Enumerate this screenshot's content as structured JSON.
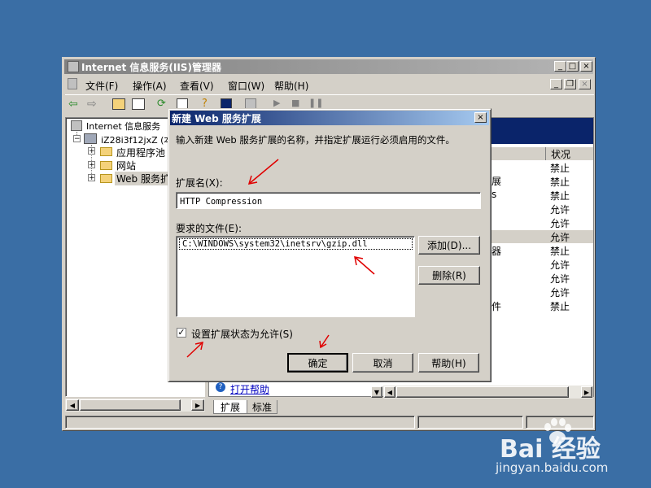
{
  "main_window": {
    "title": "Internet 信息服务(IIS)管理器",
    "menu": [
      "文件(F)",
      "操作(A)",
      "查看(V)",
      "窗口(W)",
      "帮助(H)"
    ],
    "tree": {
      "root": "Internet 信息服务",
      "server": "iZ28i3f12jxZ (本",
      "children": [
        "应用程序池",
        "网站",
        "Web 服务扩"
      ]
    },
    "right_pane": {
      "column_status": "状况",
      "partial_names": [
        "展",
        "s",
        "器",
        "件"
      ],
      "status_values": [
        "禁止",
        "禁止",
        "禁止",
        "允许",
        "允许",
        "允许",
        "禁止",
        "允许",
        "允许",
        "允许",
        "禁止",
        "禁止"
      ],
      "help_link": "打开帮助",
      "tabs": [
        "扩展",
        "标准"
      ]
    }
  },
  "dialog": {
    "title": "新建 Web 服务扩展",
    "instruction": "输入新建 Web 服务扩展的名称，并指定扩展运行必须启用的文件。",
    "ext_name_label": "扩展名(X):",
    "ext_name_value": "HTTP Compression",
    "required_files_label": "要求的文件(E):",
    "files": [
      "C:\\WINDOWS\\system32\\inetsrv\\gzip.dll"
    ],
    "add_button": "添加(D)...",
    "remove_button": "删除(R)",
    "allow_checkbox_label": "设置扩展状态为允许(S)",
    "allow_checked": true,
    "ok_button": "确定",
    "cancel_button": "取消",
    "help_button": "帮助(H)"
  },
  "watermark": {
    "logo_text": "Bai 经验",
    "url": "jingyan.baidu.com"
  },
  "colors": {
    "desktop": "#3a6ea5",
    "dialog_title": "#0a246a",
    "annotation_arrow": "#e00000"
  }
}
